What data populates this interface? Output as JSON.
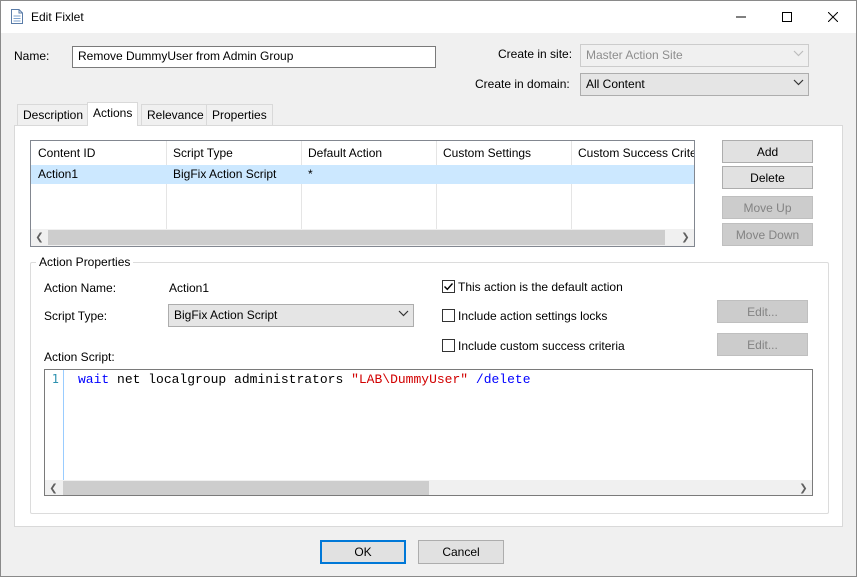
{
  "window": {
    "title": "Edit Fixlet",
    "controls": {
      "minimize": "minimize-icon",
      "maximize": "maximize-icon",
      "close": "close-icon"
    }
  },
  "form": {
    "name_label": "Name:",
    "name_value": "Remove DummyUser from Admin Group",
    "site_label": "Create in site:",
    "site_value": "Master Action Site",
    "domain_label": "Create in domain:",
    "domain_value": "All Content"
  },
  "tabs": [
    {
      "label": "Description",
      "active": false
    },
    {
      "label": "Actions",
      "active": true
    },
    {
      "label": "Relevance",
      "active": false
    },
    {
      "label": "Properties",
      "active": false
    }
  ],
  "actions_table": {
    "columns": [
      "Content ID",
      "Script Type",
      "Default Action",
      "Custom Settings",
      "Custom Success Crite"
    ],
    "rows": [
      {
        "content_id": "Action1",
        "script_type": "BigFix Action Script",
        "default_action": "*",
        "custom_settings": "",
        "custom_success": ""
      }
    ]
  },
  "side_buttons": {
    "add": "Add",
    "delete": "Delete",
    "move_up": "Move Up",
    "move_down": "Move Down"
  },
  "action_properties": {
    "group_title": "Action Properties",
    "action_name_label": "Action Name:",
    "action_name_value": "Action1",
    "script_type_label": "Script Type:",
    "script_type_value": "BigFix Action Script",
    "action_script_label": "Action Script:",
    "default_action_checkbox": {
      "label": "This action is the default action",
      "checked": true
    },
    "settings_locks_checkbox": {
      "label": "Include action settings locks",
      "checked": false
    },
    "success_criteria_checkbox": {
      "label": "Include custom success criteria",
      "checked": false
    },
    "edit_locks_label": "Edit...",
    "edit_criteria_label": "Edit..."
  },
  "script_editor": {
    "line_number": "1",
    "tokens": {
      "cmd": "wait",
      "args": " net localgroup administrators ",
      "string": "\"LAB\\DummyUser\"",
      "space": " ",
      "flag": "/delete"
    }
  },
  "footer": {
    "ok": "OK",
    "cancel": "Cancel"
  },
  "colors": {
    "selection": "#cce8ff",
    "accent": "#0078d7",
    "keyword": "#0000ff",
    "string": "#d10000"
  }
}
